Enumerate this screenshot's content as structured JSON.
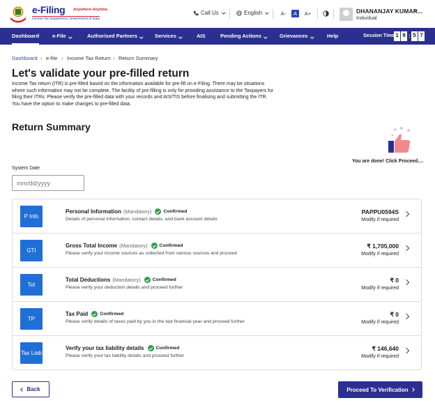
{
  "header": {
    "brand": "e-Filing",
    "tagline": "Anywhere Anytime",
    "subtitle": "Income Tax Department, Government of India",
    "call_us": "Call Us",
    "language": "English",
    "font_decrease": "A-",
    "font_normal": "A",
    "font_increase": "A+",
    "user_name": "DHANANJAY KUMAR...",
    "user_role": "Individual"
  },
  "nav": {
    "items": [
      "Dashboard",
      "e-File",
      "Authorised Partners",
      "Services",
      "AIS",
      "Pending Actions",
      "Grievances",
      "Help"
    ],
    "session_label": "Session Time",
    "session_digits": [
      "1",
      "9",
      "5",
      "7"
    ]
  },
  "breadcrumb": [
    "Dashboard",
    "e-file",
    "Income Tax Return",
    "Return Summary"
  ],
  "page": {
    "title": "Let's validate your pre-filled return",
    "description": "Income Tax return (ITR) is pre-filled based on the information available for pre-fill on e-Filing. There may be situations where such information may not be complete. The facility of pre-filling is only for providing assistance to the Taxpayers for filing their ITRs. Please verify the pre-filled data with your records and AIS/TIS before finalising and submitting the ITR. You have the option to make changes to pre-filled data.",
    "section_title": "Return Summary",
    "done_text": "You are done! Click Proceed....",
    "system_date_label": "System Date",
    "date_placeholder": "mm/dd/yyyy"
  },
  "rows": [
    {
      "badge": "P Info",
      "title": "Personal Information",
      "mandatory": "(Mandatory)",
      "status": "Confirmed",
      "desc": "Details of personal information, contact details, and bank account details",
      "value": "PAPPU0594S",
      "modify": "Modify if required"
    },
    {
      "badge": "GTI",
      "title": "Gross Total Income",
      "mandatory": "(Mandatory)",
      "status": "Confirmed",
      "desc": "Please verify your income sources as collected from various sources and proceed",
      "value": "₹ 1,705,000",
      "modify": "Modify if required"
    },
    {
      "badge": "Tot",
      "title": "Total Deductions",
      "mandatory": "(Mandatory)",
      "status": "Confirmed",
      "desc": "Please verify your deduction details and proceed further",
      "value": "₹ 0",
      "modify": "Modify if required"
    },
    {
      "badge": "TP",
      "title": "Tax Paid",
      "mandatory": "",
      "status": "Confirmed",
      "desc": "Please verify details of taxes paid by you in the last financial year and proceed further",
      "value": "₹ 0",
      "modify": "Modify if required"
    },
    {
      "badge": "Tax Liab",
      "title": "Verify your tax liability details",
      "mandatory": "",
      "status": "Confirmed",
      "desc": "Please verify your tax liability details and proceed further",
      "value": "₹ 146,640",
      "modify": "Modify if required"
    }
  ],
  "buttons": {
    "back": "Back",
    "proceed": "Proceed To Verification"
  },
  "colors": {
    "nav_bg": "#2b2f8f",
    "badge_bg": "#1f6fd6",
    "confirmed_green": "#2e9e44",
    "brand_blue": "#1f2a8a",
    "brand_red": "#d2232a"
  }
}
